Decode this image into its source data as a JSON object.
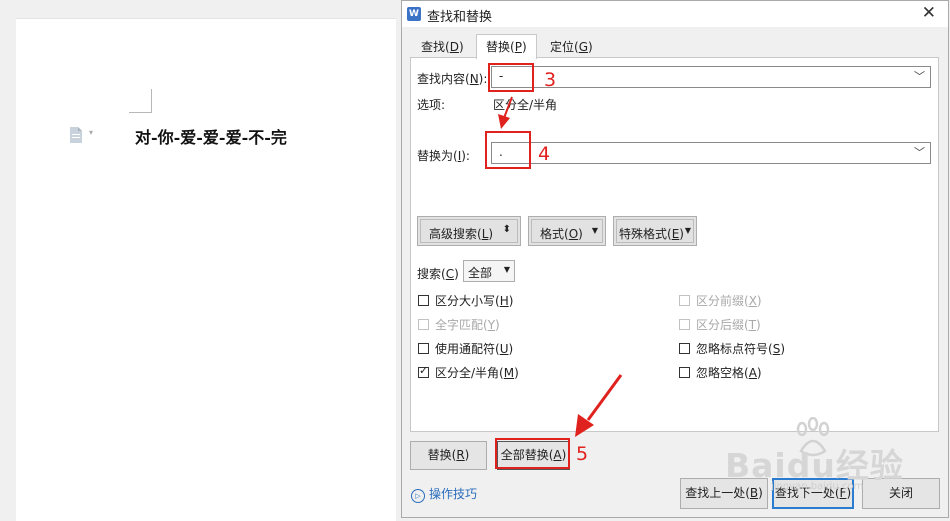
{
  "document": {
    "text": "对-你-爱-爱-爱-不-完",
    "page_icon": "document-icon",
    "caret_glyph": "▾"
  },
  "dialog": {
    "app_icon_letter": "W",
    "title": "查找和替换",
    "close_glyph": "✕",
    "tabs": [
      {
        "label": "查找(",
        "hotkey": "D",
        "tail": ")",
        "active": false
      },
      {
        "label": "替换(",
        "hotkey": "P",
        "tail": ")",
        "active": true
      },
      {
        "label": "定位(",
        "hotkey": "G",
        "tail": ")",
        "active": false
      }
    ],
    "find": {
      "label": "查找内容(",
      "hotkey": "N",
      "tail": "):",
      "value": "-"
    },
    "options": {
      "label": "选项:",
      "value": "区分全/半角"
    },
    "replace": {
      "label": "替换为(",
      "hotkey": "I",
      "tail": "):",
      "value": "."
    },
    "dropdown_glyph": "﹀",
    "advanced_search_button": {
      "label": "高级搜索(",
      "hotkey": "L",
      "tail": ")",
      "icon": "⬍"
    },
    "format_button": {
      "label": "格式(",
      "hotkey": "O",
      "tail": ")",
      "icon": "▼"
    },
    "special_format_button": {
      "label": "特殊格式(",
      "hotkey": "E",
      "tail": ")",
      "icon": "▼"
    },
    "search": {
      "label": "搜索(",
      "hotkey": "C",
      "tail": ")",
      "value": "全部",
      "caret": "▼"
    },
    "checkboxes_left": [
      {
        "label": "区分大小写(",
        "hotkey": "H",
        "tail": ")",
        "checked": false,
        "disabled": false
      },
      {
        "label": "全字匹配(",
        "hotkey": "Y",
        "tail": ")",
        "checked": false,
        "disabled": true
      },
      {
        "label": "使用通配符(",
        "hotkey": "U",
        "tail": ")",
        "checked": false,
        "disabled": false
      },
      {
        "label": "区分全/半角(",
        "hotkey": "M",
        "tail": ")",
        "checked": true,
        "disabled": false
      }
    ],
    "checkboxes_right": [
      {
        "label": "区分前缀(",
        "hotkey": "X",
        "tail": ")",
        "checked": false,
        "disabled": true
      },
      {
        "label": "区分后缀(",
        "hotkey": "T",
        "tail": ")",
        "checked": false,
        "disabled": true
      },
      {
        "label": "忽略标点符号(",
        "hotkey": "S",
        "tail": ")",
        "checked": false,
        "disabled": false
      },
      {
        "label": "忽略空格(",
        "hotkey": "A",
        "tail": ")",
        "checked": false,
        "disabled": false
      }
    ],
    "check_glyph": "✓",
    "replace_button": {
      "label": "替换(",
      "hotkey": "R",
      "tail": ")"
    },
    "replace_all_button": {
      "label": "全部替换(",
      "hotkey": "A",
      "tail": ")"
    },
    "tips_link": {
      "label": "操作技巧",
      "icon": "▷"
    },
    "find_prev_button": {
      "label": "查找上一处(",
      "hotkey": "B",
      "tail": ")"
    },
    "find_next_button": {
      "label": "查找下一处(",
      "hotkey": "F",
      "tail": ")"
    },
    "close_button": {
      "label": "关闭"
    }
  },
  "annotations": {
    "step3": "3",
    "step4": "4",
    "step5": "5",
    "color": "#e0221e"
  },
  "watermark": {
    "text": "Baidu经验",
    "subtext": "jingyan.baidu.com"
  }
}
